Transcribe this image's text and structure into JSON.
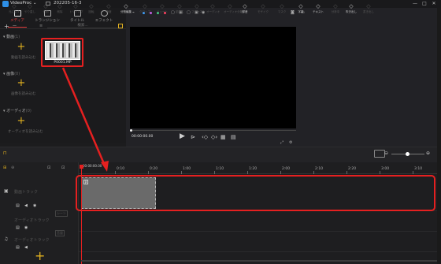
{
  "titlebar": {
    "app_name": "VideoProc ⌄",
    "project_name": "202205-16-3",
    "win_controls": [
      "—",
      "□",
      "✕"
    ]
  },
  "media_tabs": [
    {
      "label": "メディア",
      "icon": "media-icon",
      "active": true
    },
    {
      "label": "トランジション",
      "icon": "transition-icon",
      "active": false
    },
    {
      "label": "タイトル",
      "icon": "title-icon",
      "active": false
    },
    {
      "label": "エフェクト",
      "icon": "effect-icon",
      "active": false
    }
  ],
  "subbar": {
    "add": "+",
    "remove": "—",
    "search_placeholder": "検索...",
    "sort_icon": "list-icon"
  },
  "sections": [
    {
      "name": "▾ 動画",
      "count": "(1)",
      "add_label": "動画を読み込む"
    },
    {
      "name": "▾ 画像",
      "count": "(0)",
      "add_label": "画像を読み込む"
    },
    {
      "name": "▾ オーディオ",
      "count": "(0)",
      "add_label": "オーディオを読み込む"
    }
  ],
  "media_item": {
    "filename": "P0001.MP"
  },
  "preview": {
    "top_icons": [
      "wifi-icon",
      "dot-blue",
      "dot-purple",
      "dot-green",
      "dot-red",
      "square-icon",
      "lock-icon",
      "square-icon",
      "lock-icon",
      "eye-icon"
    ],
    "right_icons": [
      "camera-icon",
      "expand-icon"
    ],
    "timecode": "00:00:00.00",
    "controls": [
      "play-icon",
      "next-frame-icon",
      "prev-keyframe-icon",
      "next-keyframe-icon",
      "grid-icon",
      "snapshot-icon"
    ]
  },
  "toolbar": {
    "tools": [
      {
        "label": "元に戻す",
        "enabled": false
      },
      {
        "label": "やり直し",
        "enabled": false
      },
      {
        "label": "分割",
        "enabled": false
      },
      {
        "label": "削除",
        "enabled": false
      },
      {
        "label": "トリミング",
        "enabled": false
      },
      {
        "label": "回転",
        "enabled": false
      },
      {
        "label": "速度",
        "enabled": false
      },
      {
        "label": "分割編集",
        "enabled": true
      },
      {
        "label": "クロップ",
        "enabled": false
      },
      {
        "label": "ミュート",
        "enabled": false
      },
      {
        "label": "逆再生",
        "enabled": false
      },
      {
        "label": "フリーズ",
        "enabled": false
      },
      {
        "label": "オーディオ",
        "enabled": false
      },
      {
        "label": "オーディオ分離",
        "enabled": false
      },
      {
        "label": "録音",
        "enabled": true
      },
      {
        "label": "モザイク",
        "enabled": false
      },
      {
        "label": "マスク",
        "enabled": false
      },
      {
        "label": "字幕",
        "enabled": true
      },
      {
        "label": "テキスト",
        "enabled": true
      },
      {
        "label": "分析中",
        "enabled": false
      },
      {
        "label": "吹き出し",
        "enabled": true
      },
      {
        "label": "書き出し",
        "enabled": false
      },
      {
        "label": "自動フィット",
        "enabled": true
      }
    ],
    "zoom_minus": "⊖",
    "zoom_plus": "⊕"
  },
  "timeline": {
    "ruler_start": "00:00:00.00",
    "ticks": [
      "0:10",
      "0:20",
      "1:00",
      "1:10",
      "1:20",
      "2:00",
      "2:10",
      "2:20",
      "3:00",
      "3:10"
    ],
    "tracks": [
      {
        "name": "動画トラック",
        "icon": "video-track-icon"
      },
      {
        "name": "オーディオトラック",
        "icon": "audio-track-icon"
      },
      {
        "name": "オーディオトラック",
        "icon": "music-track-icon"
      }
    ],
    "track_badges": [
      "シーン",
      "音量"
    ],
    "add_track": "+"
  },
  "annotation": {
    "color": "#e52020"
  }
}
